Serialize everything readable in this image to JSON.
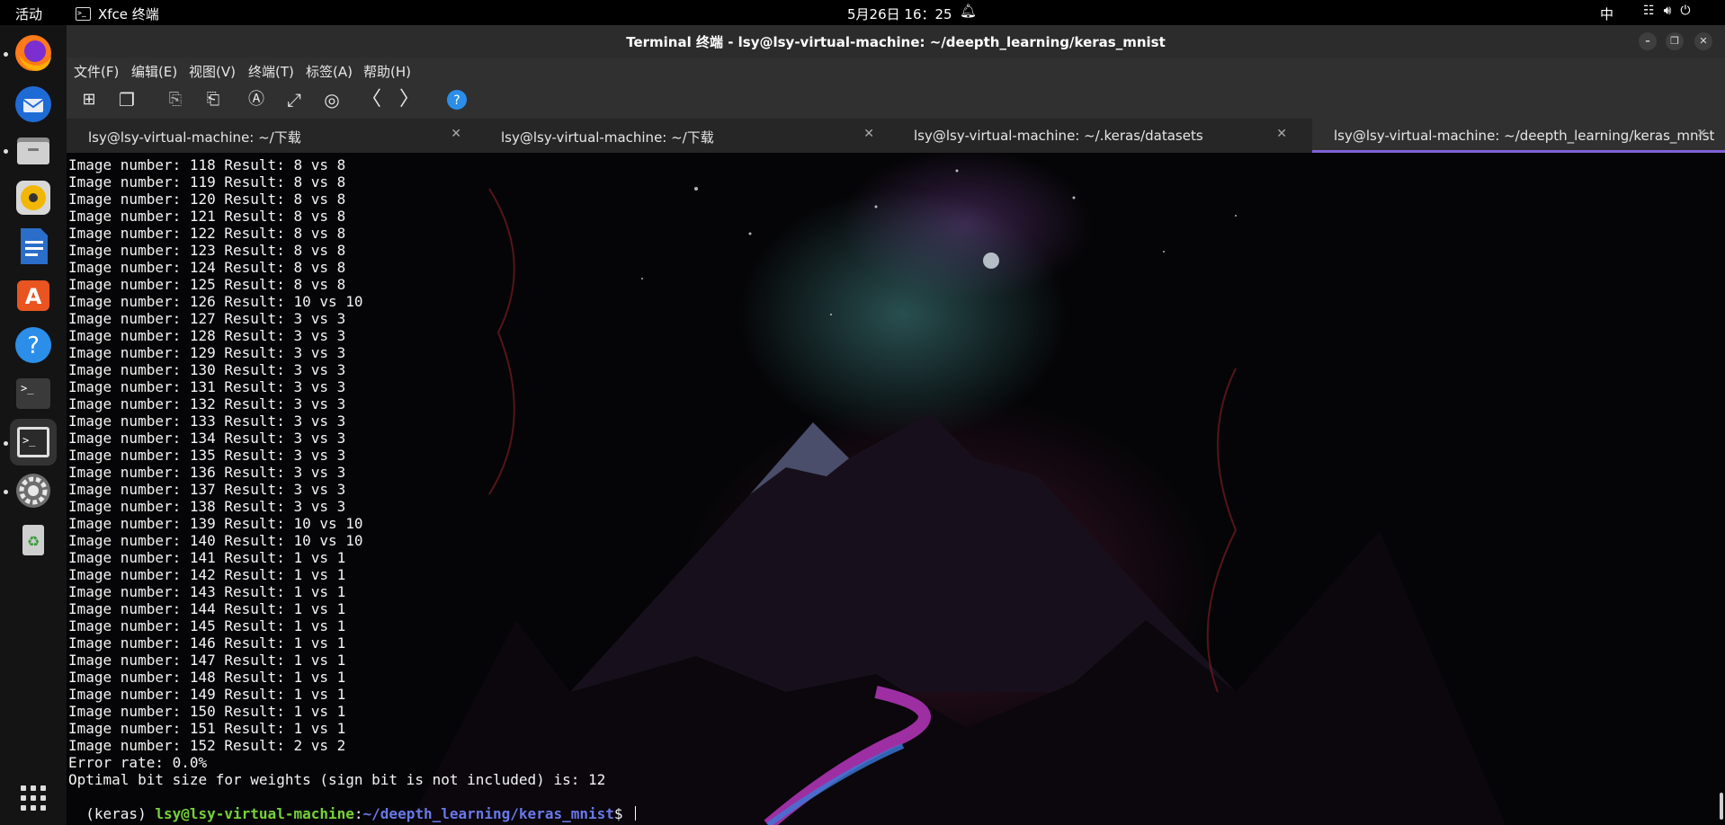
{
  "topbar": {
    "activities": "活动",
    "app_name": "Xfce 终端",
    "clock": "5月26日  16：25",
    "input_method": "中"
  },
  "dock": {
    "items": [
      {
        "name": "firefox",
        "icon": "firefox-icon",
        "running": true
      },
      {
        "name": "thunderbird",
        "icon": "thunderbird-icon",
        "running": false
      },
      {
        "name": "files",
        "icon": "files-icon",
        "running": true
      },
      {
        "name": "rhythmbox",
        "icon": "rhythmbox-icon",
        "running": false
      },
      {
        "name": "writer",
        "icon": "libreoffice-writer-icon",
        "running": false
      },
      {
        "name": "software",
        "icon": "app-store-icon",
        "running": false
      },
      {
        "name": "help",
        "icon": "help-icon",
        "running": false
      },
      {
        "name": "terminal",
        "icon": "terminal-icon",
        "running": false
      },
      {
        "name": "xfce-terminal",
        "icon": "terminal-icon",
        "running": true
      },
      {
        "name": "settings",
        "icon": "settings-icon",
        "running": true
      },
      {
        "name": "trash",
        "icon": "trash-icon",
        "running": false
      },
      {
        "name": "app-grid",
        "icon": "app-grid-icon",
        "running": false
      }
    ]
  },
  "window": {
    "title": "Terminal 终端 - lsy@lsy-virtual-machine: ~/deepth_learning/keras_mnist"
  },
  "menubar": {
    "items": [
      "文件(F)",
      "编辑(E)",
      "视图(V)",
      "终端(T)",
      "标签(A)",
      "帮助(H)"
    ]
  },
  "tabs": [
    {
      "label": "lsy@lsy-virtual-machine: ~/下载",
      "active": false
    },
    {
      "label": "lsy@lsy-virtual-machine: ~/下载",
      "active": false
    },
    {
      "label": "lsy@lsy-virtual-machine: ~/.keras/datasets",
      "active": false
    },
    {
      "label": "lsy@lsy-virtual-machine: ~/deepth_learning/keras_mnist",
      "active": true
    }
  ],
  "terminal": {
    "lines": [
      "Image number: 118 Result: 8 vs 8",
      "Image number: 119 Result: 8 vs 8",
      "Image number: 120 Result: 8 vs 8",
      "Image number: 121 Result: 8 vs 8",
      "Image number: 122 Result: 8 vs 8",
      "Image number: 123 Result: 8 vs 8",
      "Image number: 124 Result: 8 vs 8",
      "Image number: 125 Result: 8 vs 8",
      "Image number: 126 Result: 10 vs 10",
      "Image number: 127 Result: 3 vs 3",
      "Image number: 128 Result: 3 vs 3",
      "Image number: 129 Result: 3 vs 3",
      "Image number: 130 Result: 3 vs 3",
      "Image number: 131 Result: 3 vs 3",
      "Image number: 132 Result: 3 vs 3",
      "Image number: 133 Result: 3 vs 3",
      "Image number: 134 Result: 3 vs 3",
      "Image number: 135 Result: 3 vs 3",
      "Image number: 136 Result: 3 vs 3",
      "Image number: 137 Result: 3 vs 3",
      "Image number: 138 Result: 3 vs 3",
      "Image number: 139 Result: 10 vs 10",
      "Image number: 140 Result: 10 vs 10",
      "Image number: 141 Result: 1 vs 1",
      "Image number: 142 Result: 1 vs 1",
      "Image number: 143 Result: 1 vs 1",
      "Image number: 144 Result: 1 vs 1",
      "Image number: 145 Result: 1 vs 1",
      "Image number: 146 Result: 1 vs 1",
      "Image number: 147 Result: 1 vs 1",
      "Image number: 148 Result: 1 vs 1",
      "Image number: 149 Result: 1 vs 1",
      "Image number: 150 Result: 1 vs 1",
      "Image number: 151 Result: 1 vs 1",
      "Image number: 152 Result: 2 vs 2",
      "Error rate: 0.0%",
      "Optimal bit size for weights (sign bit is not included) is: 12"
    ],
    "prompt": {
      "env": "(keras) ",
      "user_host": "lsy@lsy-virtual-machine",
      "sep": ":",
      "path": "~/deepth_learning/keras_mnist",
      "symbol": "$ "
    }
  }
}
